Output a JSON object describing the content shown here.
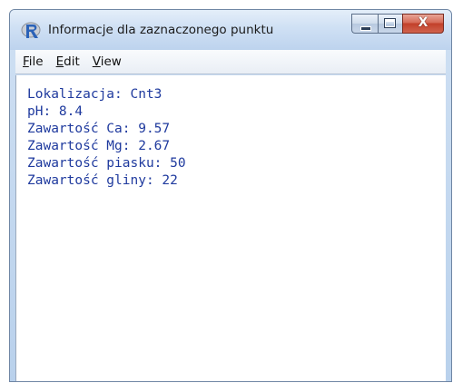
{
  "window": {
    "title": "Informacje dla zaznaczonego punktu",
    "app_icon": "r-logo-icon",
    "controls": {
      "minimize": "minimize-icon",
      "maximize": "maximize-icon",
      "close": "close-icon",
      "close_glyph": "X"
    }
  },
  "menu": {
    "items": [
      {
        "accel": "F",
        "rest": "ile"
      },
      {
        "accel": "E",
        "rest": "dit"
      },
      {
        "accel": "V",
        "rest": "iew"
      }
    ]
  },
  "content": {
    "lines": [
      "Lokalizacja: Cnt3",
      "pH: 8.4",
      "Zawartość Ca: 9.57",
      "Zawartość Mg: 2.67",
      "Zawartość piasku: 50",
      "Zawartość gliny: 22"
    ]
  },
  "colors": {
    "text": "#1f3a9e",
    "close_button": "#c2402a",
    "titlebar": "#cfe0f4"
  }
}
